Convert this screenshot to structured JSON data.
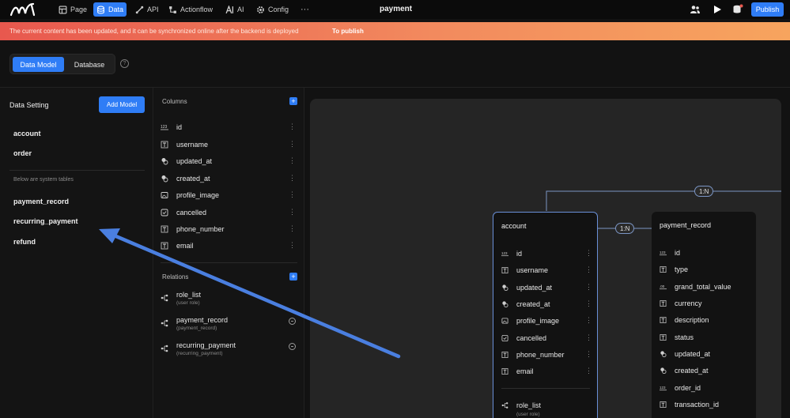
{
  "topbar": {
    "nav": [
      {
        "label": "Page",
        "icon": "page-icon"
      },
      {
        "label": "Data",
        "icon": "database-icon",
        "active": true
      },
      {
        "label": "API",
        "icon": "api-icon"
      },
      {
        "label": "Actionflow",
        "icon": "actionflow-icon"
      },
      {
        "label": "AI",
        "icon": "ai-icon"
      },
      {
        "label": "Config",
        "icon": "gear-icon"
      }
    ],
    "more": "···",
    "title": "payment",
    "publish": "Publish"
  },
  "banner": {
    "message": "The current content has been updated, and it can be synchronized online after the backend is deployed",
    "link": "To publish"
  },
  "tabs": {
    "data_model": "Data Model",
    "database": "Database",
    "help": "?"
  },
  "left_panel": {
    "title": "Data Setting",
    "add_model": "Add Model",
    "models": [
      "account",
      "order"
    ],
    "system_label": "Below are system tables",
    "system_models": [
      "payment_record",
      "recurring_payment",
      "refund"
    ]
  },
  "middle_panel": {
    "columns_title": "Columns",
    "columns": [
      {
        "name": "id",
        "icon": "id-icon"
      },
      {
        "name": "username",
        "icon": "text-icon"
      },
      {
        "name": "updated_at",
        "icon": "datetime-icon"
      },
      {
        "name": "created_at",
        "icon": "datetime-icon"
      },
      {
        "name": "profile_image",
        "icon": "image-icon"
      },
      {
        "name": "cancelled",
        "icon": "checkbox-icon"
      },
      {
        "name": "phone_number",
        "icon": "text-icon"
      },
      {
        "name": "email",
        "icon": "text-icon"
      }
    ],
    "relations_title": "Relations",
    "relations": [
      {
        "name": "role_list",
        "sub": "(user role)",
        "removable": false
      },
      {
        "name": "payment_record",
        "sub": "(payment_record)",
        "removable": true
      },
      {
        "name": "recurring_payment",
        "sub": "(recurring_payment)",
        "removable": true
      }
    ]
  },
  "canvas": {
    "account": {
      "title": "account",
      "fields": [
        {
          "name": "id",
          "icon": "id-icon"
        },
        {
          "name": "username",
          "icon": "text-icon"
        },
        {
          "name": "updated_at",
          "icon": "datetime-icon"
        },
        {
          "name": "created_at",
          "icon": "datetime-icon"
        },
        {
          "name": "profile_image",
          "icon": "image-icon"
        },
        {
          "name": "cancelled",
          "icon": "checkbox-icon"
        },
        {
          "name": "phone_number",
          "icon": "text-icon"
        },
        {
          "name": "email",
          "icon": "text-icon"
        }
      ],
      "relation": {
        "name": "role_list",
        "sub": "(user role)"
      }
    },
    "payment_record": {
      "title": "payment_record",
      "fields": [
        {
          "name": "id",
          "icon": "id-icon"
        },
        {
          "name": "type",
          "icon": "text-icon"
        },
        {
          "name": "grand_total_value",
          "icon": "decimal-icon"
        },
        {
          "name": "currency",
          "icon": "text-icon"
        },
        {
          "name": "description",
          "icon": "text-icon"
        },
        {
          "name": "status",
          "icon": "text-icon"
        },
        {
          "name": "updated_at",
          "icon": "datetime-icon"
        },
        {
          "name": "created_at",
          "icon": "datetime-icon"
        },
        {
          "name": "order_id",
          "icon": "id-icon"
        },
        {
          "name": "transaction_id",
          "icon": "text-icon"
        }
      ]
    },
    "badges": [
      "1:N",
      "1:N"
    ]
  },
  "colors": {
    "accent": "#2f7df6",
    "banner_start": "#e8584e",
    "banner_end": "#f7a45e",
    "arrow": "#4a7fe0"
  }
}
